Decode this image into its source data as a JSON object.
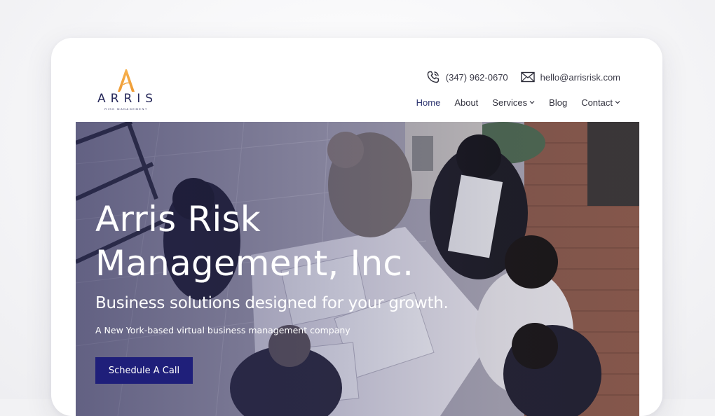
{
  "brand": {
    "name": "ARRIS",
    "tagline": "RISK MANAGEMENT",
    "accent_color": "#f2a541",
    "navy_color": "#27295a"
  },
  "header": {
    "phone": "(347) 962-0670",
    "email": "hello@arrisrisk.com",
    "phone_icon": "phone-icon",
    "email_icon": "mail-icon"
  },
  "nav": {
    "items": [
      {
        "label": "Home",
        "active": true
      },
      {
        "label": "About"
      },
      {
        "label": "Services",
        "has_dropdown": true
      },
      {
        "label": "Blog"
      },
      {
        "label": "Contact",
        "has_dropdown": true
      }
    ]
  },
  "hero": {
    "title_line1": "Arris Risk",
    "title_line2": "Management, Inc.",
    "subtitle": "Business solutions designed for your growth.",
    "description": "A New York-based virtual business management company",
    "cta_label": "Schedule A Call",
    "cta_color": "#1f1f7a"
  }
}
